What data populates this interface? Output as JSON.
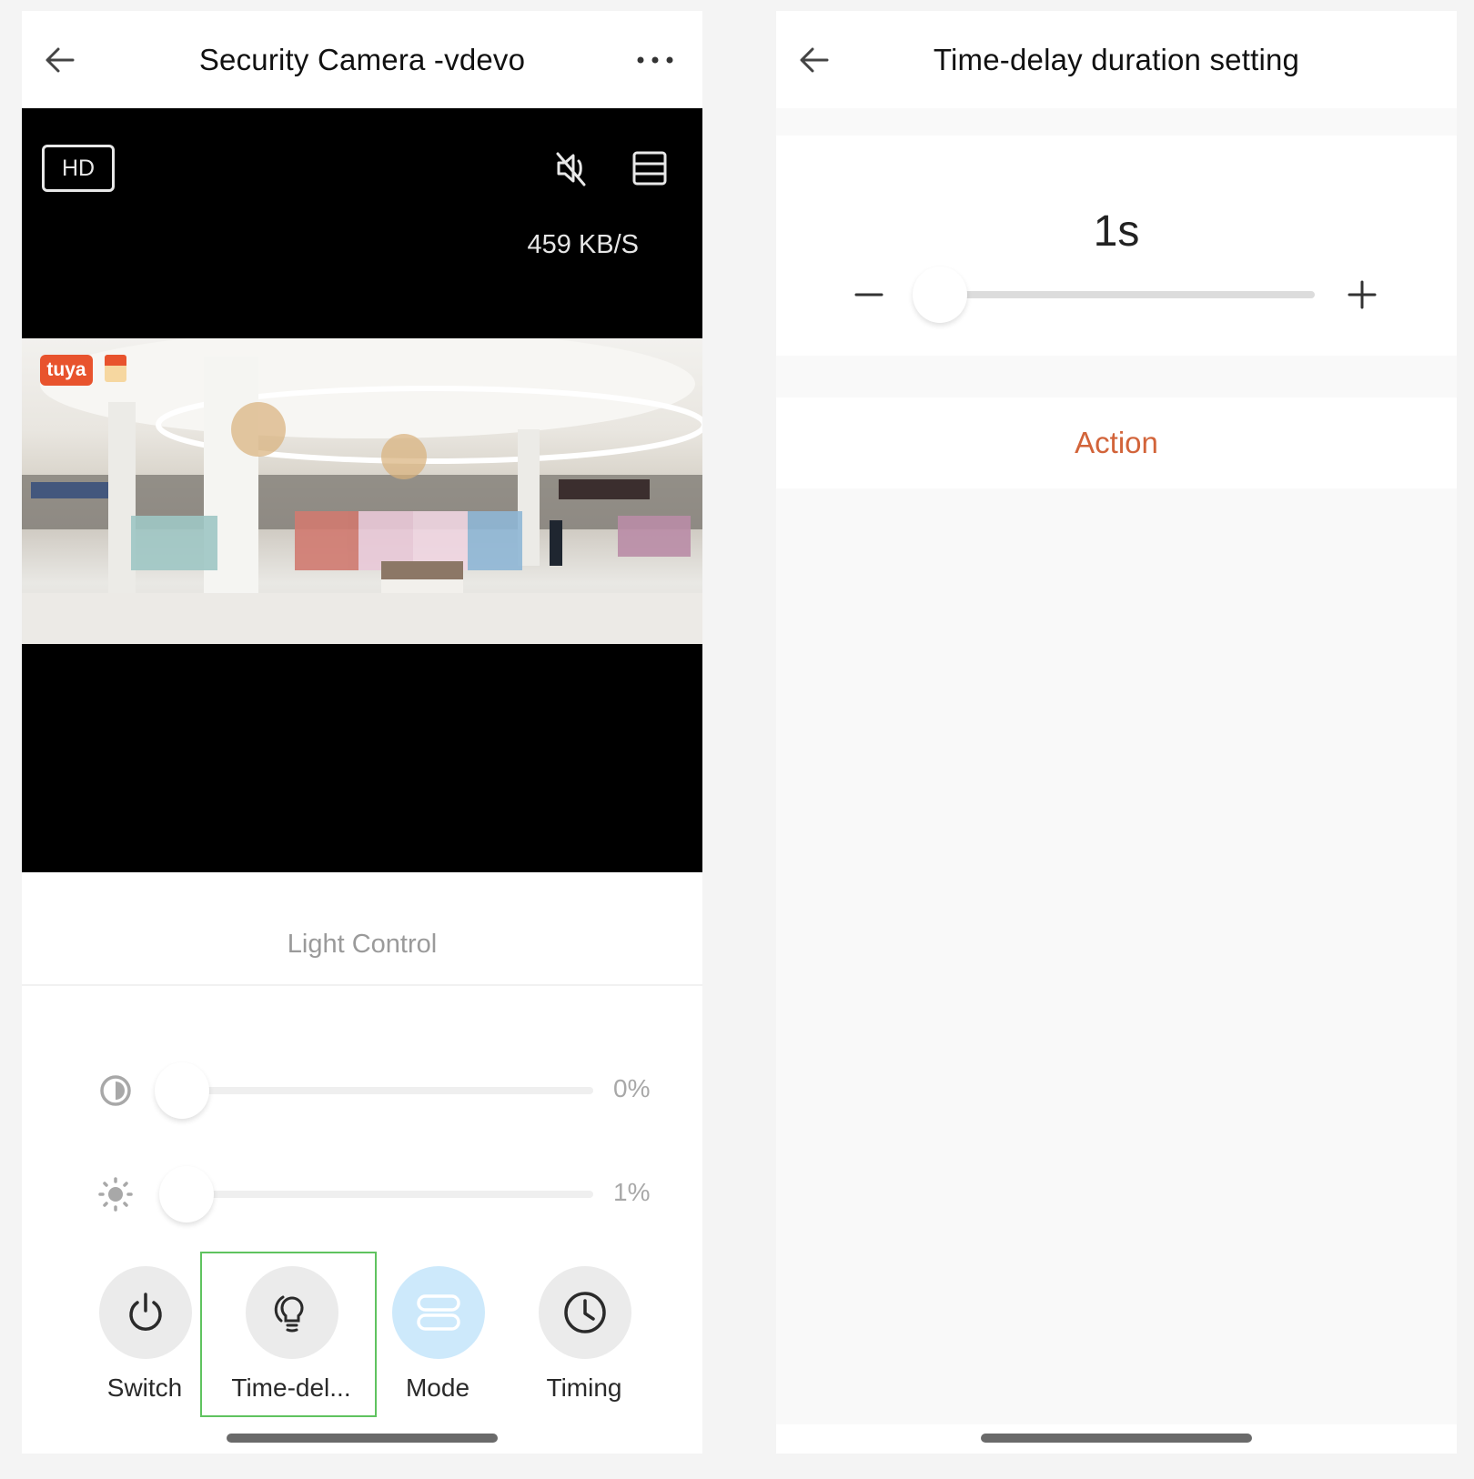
{
  "left_screen": {
    "navbar": {
      "title": "Security Camera -vdevo",
      "back_icon": "arrow-left-icon",
      "more_icon": "more-horizontal-icon"
    },
    "video": {
      "quality_label": "HD",
      "mute_icon": "speaker-muted-icon",
      "layout_icon": "layout-rows-icon",
      "bitrate": "459 KB/S",
      "watermark_brand": "tuya"
    },
    "light_control": {
      "title": "Light Control",
      "sliders": [
        {
          "name": "contrast",
          "icon": "contrast-icon",
          "value_percent": 0,
          "value_label": "0%"
        },
        {
          "name": "brightness",
          "icon": "sun-icon",
          "value_percent": 1,
          "value_label": "1%"
        }
      ],
      "buttons": [
        {
          "label": "Switch",
          "icon": "power-icon",
          "active": false,
          "focused": false
        },
        {
          "label": "Time-del...",
          "icon": "bulb-icon",
          "active": false,
          "focused": true
        },
        {
          "label": "Mode",
          "icon": "mode-icon",
          "active": true,
          "focused": false
        },
        {
          "label": "Timing",
          "icon": "clock-icon",
          "active": false,
          "focused": false
        }
      ]
    }
  },
  "right_screen": {
    "navbar": {
      "title": "Time-delay duration setting",
      "back_icon": "arrow-left-icon"
    },
    "duration": {
      "value_label": "1s",
      "slider_fraction": 0.0,
      "minus_label": "−",
      "plus_label": "+"
    },
    "action": {
      "label": "Action",
      "color": "#d2643a"
    }
  },
  "colors": {
    "focus_outline": "#5fc35f",
    "mode_active_bg": "#cde9fb",
    "action_text": "#d2643a"
  }
}
